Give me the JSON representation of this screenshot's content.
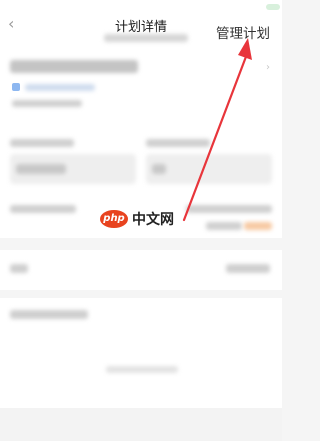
{
  "header": {
    "back_glyph": "‹",
    "title": "计划详情",
    "manage_label": "管理计划"
  },
  "watermark": {
    "logo_text": "php",
    "text": "中文网"
  },
  "colors": {
    "arrow": "#e8353b",
    "watermark_logo": "#e8431f",
    "accent_blue": "#8db7f0",
    "accent_orange": "#f5a25a"
  }
}
